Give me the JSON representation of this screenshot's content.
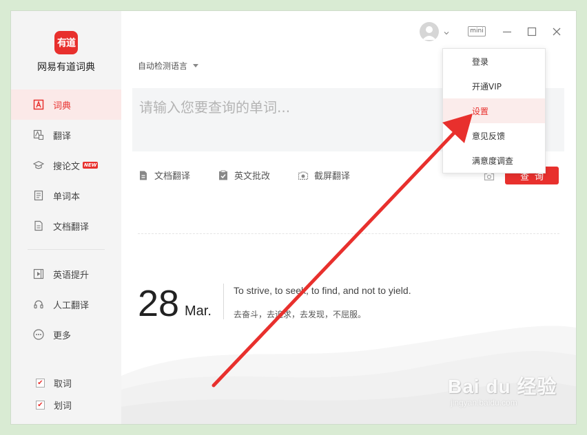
{
  "app": {
    "logo_text": "有道",
    "name": "网易有道词典"
  },
  "sidebar": {
    "items": [
      {
        "label": "词典",
        "icon": "dictionary-icon"
      },
      {
        "label": "翻译",
        "icon": "translate-icon"
      },
      {
        "label": "搜论文",
        "icon": "graduation-cap-icon",
        "badge": "NEW"
      },
      {
        "label": "单词本",
        "icon": "wordbook-icon"
      },
      {
        "label": "文档翻译",
        "icon": "document-icon"
      }
    ],
    "items2": [
      {
        "label": "英语提升",
        "icon": "video-icon"
      },
      {
        "label": "人工翻译",
        "icon": "headset-icon"
      },
      {
        "label": "更多",
        "icon": "more-icon"
      }
    ],
    "checks": [
      {
        "label": "取词",
        "checked": true
      },
      {
        "label": "划词",
        "checked": true
      }
    ]
  },
  "main": {
    "lang_select": "自动检测语言",
    "search_placeholder": "请输入您要查询的单词...",
    "tools": [
      "文档翻译",
      "英文批改",
      "截屏翻译"
    ],
    "query_label": "查询",
    "daily": {
      "day": "28",
      "month": "Mar.",
      "quote_en": "To strive, to seek, to find, and not to yield.",
      "quote_cn": "去奋斗，去追求，去发现，不屈服。"
    }
  },
  "titlebar": {
    "mini_label": "mini"
  },
  "dropdown": {
    "items": [
      "登录",
      "开通VIP",
      "设置",
      "意见反馈",
      "满意度调查"
    ],
    "highlighted_index": 2
  },
  "watermark": {
    "main": "Bai du 经验",
    "sub": "jingyan.baidu.com"
  },
  "colors": {
    "accent": "#e8302d",
    "background": "#d9ebd3",
    "sidebar": "#f4f4f4"
  }
}
